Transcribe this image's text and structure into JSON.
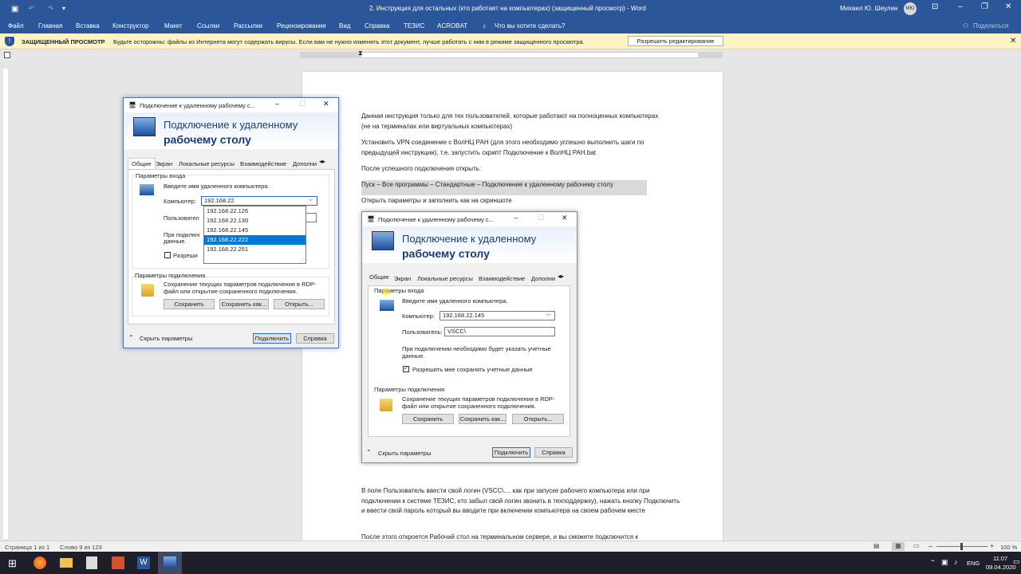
{
  "titlebar": {
    "title": "2. Инструкция для остальных (кто работает на компьютерах) (защищенный просмотр) - Word",
    "user": "Михаил Ю. Шеулин",
    "user_initials": "МЮ"
  },
  "ribbon": {
    "items": [
      "Файл",
      "Главная",
      "Вставка",
      "Конструктор",
      "Макет",
      "Ссылки",
      "Рассылки",
      "Рецензирование",
      "Вид",
      "Справка",
      "ТЕЗИС",
      "ACROBAT"
    ],
    "search": "Что вы хотите сделать?",
    "share": "Поделиться"
  },
  "protected": {
    "label": "ЗАЩИЩЕННЫЙ ПРОСМОТР",
    "message": "Будьте осторожны: файлы из Интернета могут содержать вирусы. Если вам не нужно изменять этот документ, лучше работать с ним в режиме защищенного просмотра.",
    "button": "Разрешить редактирование"
  },
  "doc": {
    "p1": "Данная инструкция только для тех пользователей, которые работают на полноценных компьютерах (не на терминалах или виртуальных компьютерах)",
    "p2": "Установить VPN соединение с ВолНЦ РАН (для этого необходимо успешно выполнить шаги по предыдущей инструкции), т.е. запустить скрипт Подключение к ВолНЦ РАН.bat",
    "p3": "После успешного подключения открыть:",
    "p4": "Пуск – Все программы – Стандартные – Подключение к удаленному рабочему столу",
    "p5": "Открыть параметры и заполнить как на скриншоте",
    "p6": "В поле Пользователь ввести свой логин (VSCC\\.... как при запуске рабочего компьютера или при подключении к  системе ТЕЗИС, кто забыл свой логин звонить в техподдержку), нажать кнопку Подключить и ввести свой пароль который вы вводите при включении компьютера на своем рабочем месте",
    "p7": "После этого откроется Рабочий стол на терминальном сервере, и вы сможете подключится к"
  },
  "rdp": {
    "title": "Подключение к удаленному рабочему с...",
    "banner1": "Подключение к удаленному",
    "banner2": "рабочему столу",
    "tabs": [
      "Общие",
      "Экран",
      "Локальные ресурсы",
      "Взаимодействие",
      "Дополни"
    ],
    "login_group": "Параметры входа",
    "enter_name": "Введите имя удаленного компьютера.",
    "computer_label": "Компьютер:",
    "user_label": "Пользователь:",
    "note": "При подключении необходимо будет указать учетные данные.",
    "save_creds": "Разрешить мне сохранять учетные данные",
    "conn_group": "Параметры подключения",
    "conn_text": "Сохранение текущих параметров подключения в RDP-файл или открытие сохраненного подключения.",
    "save": "Сохранить",
    "save_as": "Сохранить как...",
    "open": "Открыть...",
    "hide": "Скрыть параметры",
    "connect": "Подключить",
    "help": "Справка"
  },
  "live": {
    "computer_value": "192.168.22",
    "dropdown": [
      "192.168.22.126",
      "192.168.22.130",
      "192.168.22.145",
      "192.168.22.222",
      "192.168.22.251"
    ],
    "selected_index": 3,
    "user_short": "Пользовател",
    "note_short": "При подключ",
    "note_short2": "данные.",
    "save_short": "Разреши"
  },
  "shot": {
    "computer_value": "192.168.22.145",
    "user_value": "VSCC\\",
    "tab_first": "Общие",
    "conn_short": "Параметры подключения"
  },
  "status": {
    "page": "Страница 1 из 1",
    "words": "Слово 9 из 123",
    "zoom": "100 %"
  },
  "taskbar": {
    "time": "11:07",
    "date": "09.04.2020",
    "lang": "ENG"
  }
}
